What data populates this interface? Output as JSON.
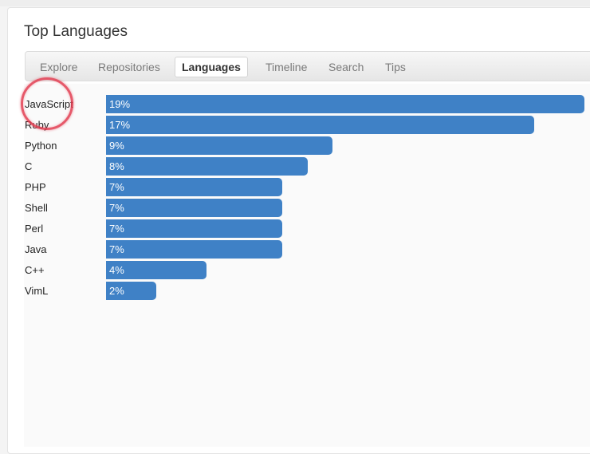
{
  "page": {
    "title": "Top Languages"
  },
  "tabs": [
    {
      "label": "Explore",
      "active": false
    },
    {
      "label": "Repositories",
      "active": false
    },
    {
      "label": "Languages",
      "active": true
    },
    {
      "label": "Timeline",
      "active": false
    },
    {
      "label": "Search",
      "active": false
    },
    {
      "label": "Tips",
      "active": false
    }
  ],
  "colors": {
    "bar": "#3f81c6",
    "annotation": "#e23c50"
  },
  "chart_data": {
    "type": "bar",
    "orientation": "horizontal",
    "categories": [
      "JavaScript",
      "Ruby",
      "Python",
      "C",
      "PHP",
      "Shell",
      "Perl",
      "Java",
      "C++",
      "VimL"
    ],
    "values": [
      19,
      17,
      9,
      8,
      7,
      7,
      7,
      7,
      4,
      2
    ],
    "value_labels": [
      "19%",
      "17%",
      "9%",
      "8%",
      "7%",
      "7%",
      "7%",
      "7%",
      "4%",
      "2%"
    ],
    "title": "",
    "xlabel": "",
    "ylabel": "",
    "xlim": [
      0,
      19
    ],
    "grid": false,
    "legend": "none"
  }
}
